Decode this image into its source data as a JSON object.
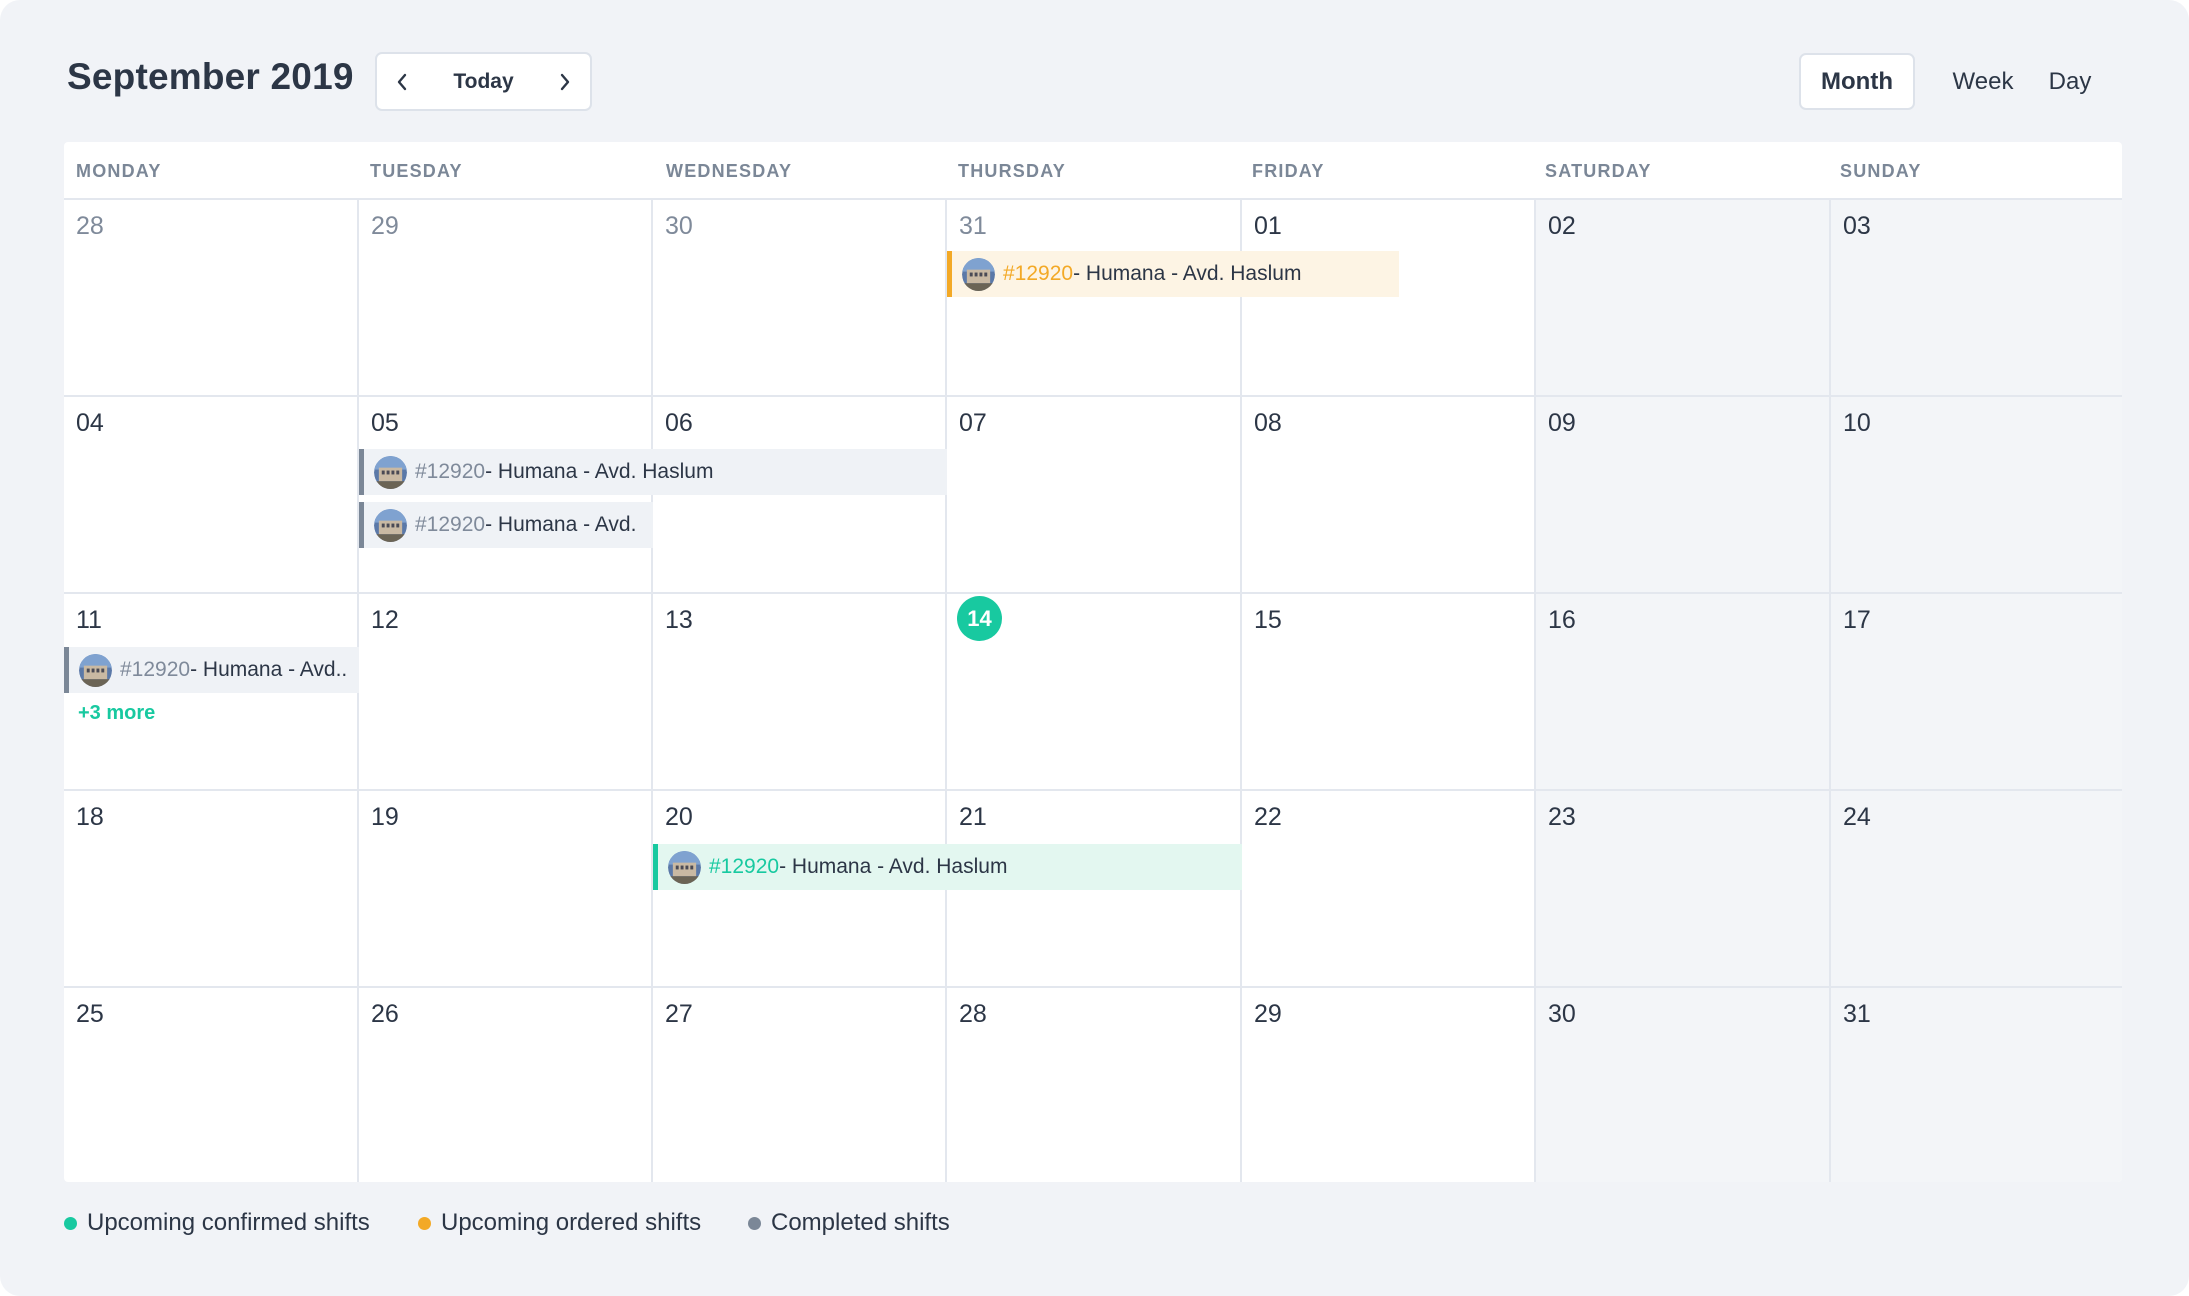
{
  "header": {
    "title": "September 2019",
    "nav": {
      "today_label": "Today",
      "prev_icon": "chevron-left-icon",
      "next_icon": "chevron-right-icon"
    },
    "views": [
      {
        "label": "Month",
        "active": true
      },
      {
        "label": "Week",
        "active": false
      },
      {
        "label": "Day",
        "active": false
      }
    ]
  },
  "weekdays": [
    "MONDAY",
    "TUESDAY",
    "WEDNESDAY",
    "THURSDAY",
    "FRIDAY",
    "SATURDAY",
    "SUNDAY"
  ],
  "weeks": [
    [
      "28",
      "29",
      "30",
      "31",
      "01",
      "02",
      "03"
    ],
    [
      "04",
      "05",
      "06",
      "07",
      "08",
      "09",
      "10"
    ],
    [
      "11",
      "12",
      "13",
      "14",
      "15",
      "16",
      "17"
    ],
    [
      "18",
      "19",
      "20",
      "21",
      "22",
      "23",
      "24"
    ],
    [
      "25",
      "26",
      "27",
      "28",
      "29",
      "30",
      "31"
    ]
  ],
  "today": "14",
  "events": {
    "w1_thu": {
      "code": "#12920",
      "text": " - Humana - Avd. Haslum",
      "status": "ordered"
    },
    "w2_tue_a": {
      "code": "#12920",
      "text": " - Humana - Avd. Haslum",
      "status": "completed"
    },
    "w2_tue_b": {
      "code": "#12920",
      "text": " - Humana - Avd.",
      "status": "completed"
    },
    "w3_mon": {
      "code": "#12920",
      "text": " - Humana - Avd..",
      "status": "completed"
    },
    "w4_wed": {
      "code": "#12920",
      "text": " - Humana - Avd. Haslum",
      "status": "confirmed"
    }
  },
  "more_label": "+3 more",
  "legend": [
    {
      "label": "Upcoming confirmed shifts",
      "color": "#18c9a0"
    },
    {
      "label": "Upcoming ordered shifts",
      "color": "#f3a926"
    },
    {
      "label": "Completed shifts",
      "color": "#7b8797"
    }
  ],
  "colors": {
    "accent": "#18c9a0",
    "ordered": "#f3a926",
    "completed": "#7b8797",
    "background": "#f1f3f7"
  }
}
